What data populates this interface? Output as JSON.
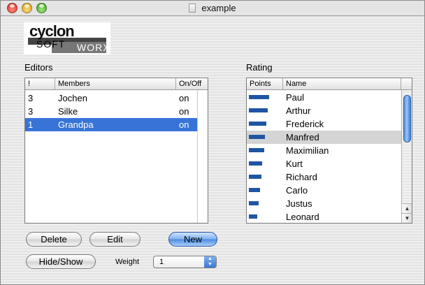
{
  "window": {
    "title": "example",
    "icons": {
      "close": "close-button",
      "minimize": "minimize-button",
      "zoom": "zoom-button",
      "document": "document-icon"
    }
  },
  "logo": {
    "line1": "cyclon",
    "line2a": "SOFT",
    "line2b": "WORX"
  },
  "editors": {
    "label": "Editors",
    "columns": [
      "!",
      "Members",
      "On/Off"
    ],
    "rows": [
      {
        "num": "3",
        "member": "Jochen",
        "status": "on",
        "selected": false
      },
      {
        "num": "3",
        "member": "Silke",
        "status": "on",
        "selected": false
      },
      {
        "num": "1",
        "member": "Grandpa",
        "status": "on",
        "selected": true
      }
    ]
  },
  "rating": {
    "label": "Rating",
    "columns": [
      "Points",
      "Name"
    ],
    "rows": [
      {
        "points": 0.97,
        "name": "Paul"
      },
      {
        "points": 0.9,
        "name": "Arthur"
      },
      {
        "points": 0.83,
        "name": "Frederick"
      },
      {
        "points": 0.76,
        "name": "Manfred",
        "highlight": true
      },
      {
        "points": 0.72,
        "name": "Maximilian"
      },
      {
        "points": 0.62,
        "name": "Kurt"
      },
      {
        "points": 0.59,
        "name": "Richard"
      },
      {
        "points": 0.52,
        "name": "Carlo"
      },
      {
        "points": 0.48,
        "name": "Justus"
      },
      {
        "points": 0.41,
        "name": "Leonard"
      }
    ],
    "scroll_position": 0.05
  },
  "buttons": {
    "delete": "Delete",
    "edit": "Edit",
    "new": "New",
    "hide_show": "Hide/Show"
  },
  "weight": {
    "label": "Weight",
    "value": "1"
  },
  "colors": {
    "selection": "#3874d7",
    "bar": "#1f55a3",
    "primary_button": "#6aa3ea"
  }
}
